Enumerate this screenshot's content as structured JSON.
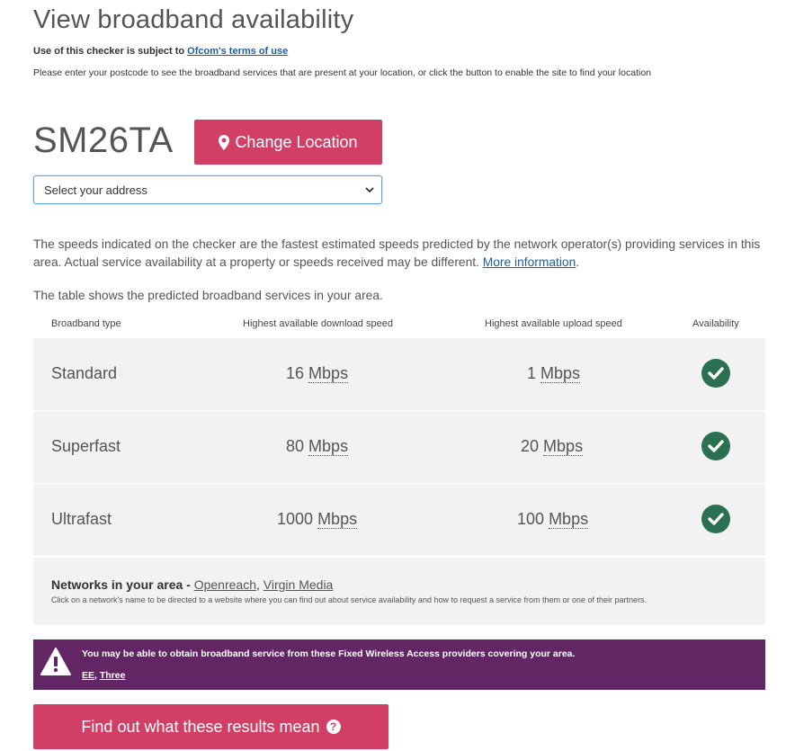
{
  "page": {
    "title": "View broadband availability",
    "terms_prefix": "Use of this checker is subject to ",
    "terms_link": "Ofcom's terms of use",
    "intro": "Please enter your postcode to see the broadband services that are present at your location, or click the button to enable the site to find your location"
  },
  "location": {
    "postcode": "SM26TA",
    "change_label": "Change Location",
    "address_select": "Select your address"
  },
  "info": {
    "speeds_text": "The speeds indicated on the checker are the fastest estimated speeds predicted by the network operator(s) providing services in this area. Actual service availability at a property or speeds received may be different. ",
    "more_info_link": "More information",
    "table_intro": "The table shows the predicted broadband services in your area."
  },
  "table": {
    "headers": [
      "Broadband type",
      "Highest available download speed",
      "Highest available upload speed",
      "Availability"
    ],
    "rows": [
      {
        "type": "Standard",
        "download": "16",
        "upload": "1",
        "unit": "Mbps",
        "available": true
      },
      {
        "type": "Superfast",
        "download": "80",
        "upload": "20",
        "unit": "Mbps",
        "available": true
      },
      {
        "type": "Ultrafast",
        "download": "1000",
        "upload": "100",
        "unit": "Mbps",
        "available": true
      }
    ]
  },
  "networks": {
    "title": "Networks in your area - ",
    "providers": [
      "Openreach",
      "Virgin Media"
    ],
    "note": "Click on a network's name to be directed to a website where you can find out about service availability and how to request a service from them or one of their partners."
  },
  "fwa": {
    "message": "You may be able to obtain broadband service from these Fixed Wireless Access providers covering your area.",
    "providers": [
      "EE",
      "Three"
    ]
  },
  "results_button": "Find out what these results mean",
  "colors": {
    "accent": "#d13f67",
    "check": "#2b7050",
    "fwa_bg": "#632665",
    "link": "#1a5f9e"
  }
}
